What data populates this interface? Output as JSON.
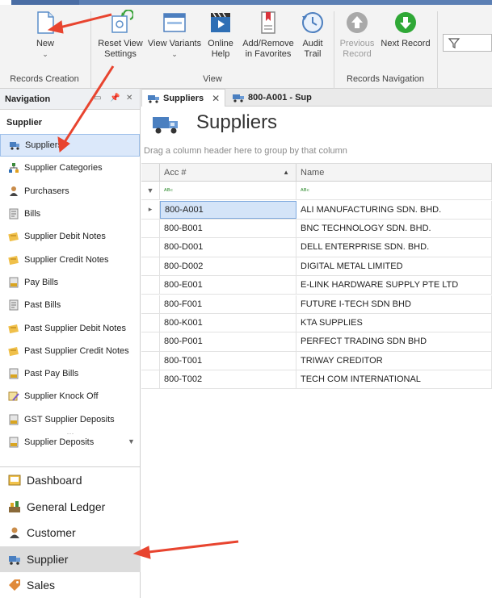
{
  "ribbon": {
    "buttons": [
      {
        "name": "new-button",
        "label1": "New",
        "label2": "",
        "caret": "⌄",
        "icon": "new-document-icon"
      },
      {
        "name": "reset-view-settings-button",
        "label1": "Reset View",
        "label2": "Settings",
        "caret": "",
        "icon": "reset-view-icon"
      },
      {
        "name": "view-variants-button",
        "label1": "View Variants",
        "label2": "",
        "caret": "⌄",
        "icon": "view-variants-icon"
      },
      {
        "name": "online-help-button",
        "label1": "Online",
        "label2": "Help",
        "caret": "",
        "icon": "film-help-icon"
      },
      {
        "name": "add-remove-favorites-button",
        "label1": "Add/Remove",
        "label2": "in Favorites",
        "caret": "",
        "icon": "bookmark-icon"
      },
      {
        "name": "audit-trail-button",
        "label1": "Audit",
        "label2": "Trail",
        "caret": "",
        "icon": "audit-trail-icon"
      },
      {
        "name": "previous-record-button",
        "label1": "Previous",
        "label2": "Record",
        "caret": "",
        "icon": "arrow-up-circle-icon"
      },
      {
        "name": "next-record-button",
        "label1": "Next Record",
        "label2": "",
        "caret": "",
        "icon": "arrow-down-circle-icon"
      }
    ],
    "groups": {
      "records_creation": "Records Creation",
      "view": "View",
      "records_navigation": "Records Navigation"
    }
  },
  "navigation": {
    "title": "Navigation",
    "pin": "📌",
    "close": "✕",
    "section": "Supplier",
    "items": [
      "Suppliers",
      "Supplier Categories",
      "Purchasers",
      "Bills",
      "Supplier Debit Notes",
      "Supplier Credit Notes",
      "Pay Bills",
      "Past Bills",
      "Past Supplier Debit Notes",
      "Past Supplier Credit Notes",
      "Past Pay Bills",
      "Supplier Knock Off",
      "GST Supplier Deposits",
      "Supplier Deposits"
    ],
    "more": "···",
    "scroll_caret": "▼",
    "modules": [
      "Dashboard",
      "General Ledger",
      "Customer",
      "Supplier",
      "Sales"
    ]
  },
  "tabs": [
    {
      "label": "Suppliers",
      "close": "✕"
    },
    {
      "label": "800-A001 - Sup",
      "close": ""
    }
  ],
  "page": {
    "title": "Suppliers",
    "group_hint": "Drag a column header here to group by that column"
  },
  "grid": {
    "columns": [
      "Acc #",
      "Name"
    ],
    "sort_arrow": "▲",
    "filter_glyph": "ᴬᴮᶜ",
    "filter_icon": "▼",
    "row_indicator": "▸",
    "rows": [
      {
        "acc": "800-A001",
        "name": "ALI MANUFACTURING SDN. BHD."
      },
      {
        "acc": "800-B001",
        "name": "BNC TECHNOLOGY SDN. BHD."
      },
      {
        "acc": "800-D001",
        "name": "DELL ENTERPRISE SDN. BHD."
      },
      {
        "acc": "800-D002",
        "name": "DIGITAL METAL LIMITED"
      },
      {
        "acc": "800-E001",
        "name": "E-LINK HARDWARE SUPPLY PTE LTD"
      },
      {
        "acc": "800-F001",
        "name": "FUTURE I-TECH SDN BHD"
      },
      {
        "acc": "800-K001",
        "name": "KTA SUPPLIES"
      },
      {
        "acc": "800-P001",
        "name": "PERFECT TRADING SDN BHD"
      },
      {
        "acc": "800-T001",
        "name": "TRIWAY CREDITOR"
      },
      {
        "acc": "800-T002",
        "name": "TECH COM INTERNATIONAL"
      }
    ]
  },
  "colors": {
    "accent": "#e8442f",
    "selection": "#dbe8fa",
    "header": "#5b7fb4"
  }
}
